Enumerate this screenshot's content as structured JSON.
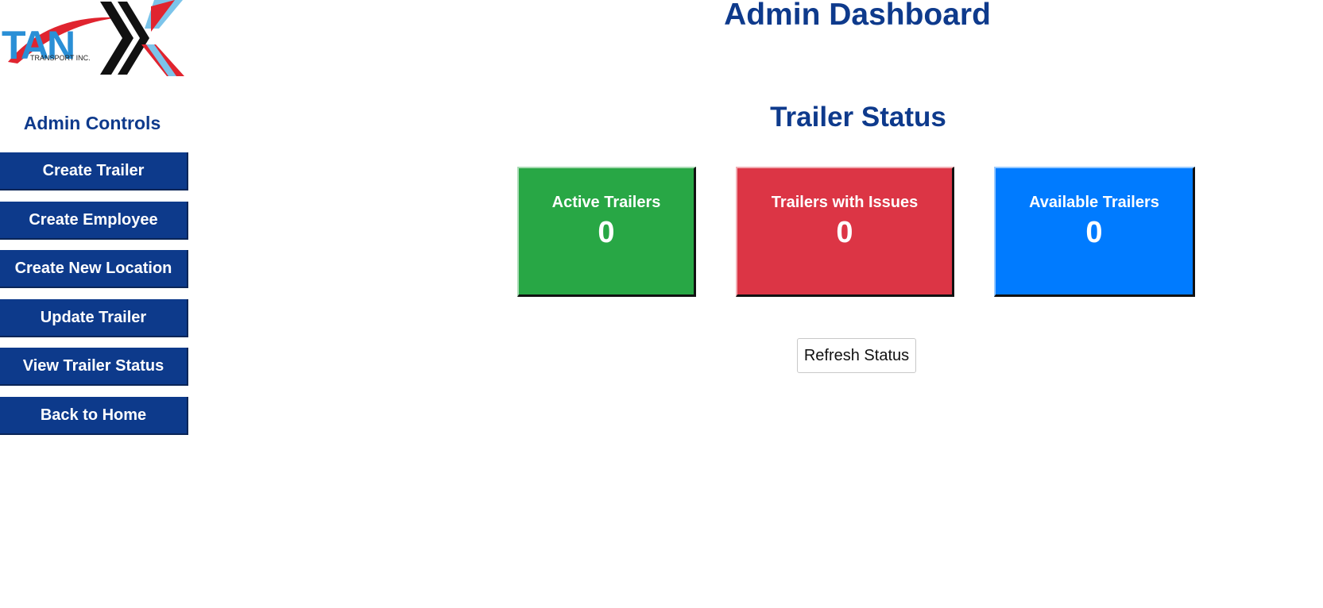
{
  "brand": {
    "logo_text": "TAN",
    "logo_subtext": "TRANSPORT INC."
  },
  "sidebar": {
    "title": "Admin Controls",
    "items": [
      {
        "label": "Create Trailer"
      },
      {
        "label": "Create Employee"
      },
      {
        "label": "Create New Location"
      },
      {
        "label": "Update Trailer"
      },
      {
        "label": "View Trailer Status"
      },
      {
        "label": "Back to Home"
      }
    ]
  },
  "header": {
    "title": "Admin Dashboard"
  },
  "trailer_status": {
    "title": "Trailer Status",
    "cards": [
      {
        "label": "Active Trailers",
        "value": "0",
        "color": "#28a745"
      },
      {
        "label": "Trailers with Issues",
        "value": "0",
        "color": "#dc3545"
      },
      {
        "label": "Available Trailers",
        "value": "0",
        "color": "#007bff"
      }
    ],
    "refresh_label": "Refresh Status"
  },
  "colors": {
    "accent": "#0e3a8c",
    "nav_button": "#0d3a8b"
  }
}
